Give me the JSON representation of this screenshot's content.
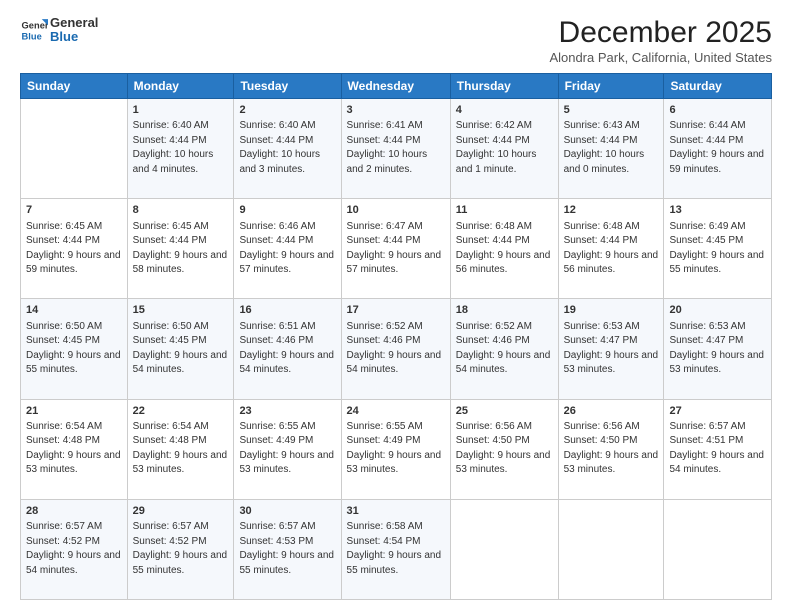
{
  "logo": {
    "line1": "General",
    "line2": "Blue"
  },
  "title": "December 2025",
  "location": "Alondra Park, California, United States",
  "days_header": [
    "Sunday",
    "Monday",
    "Tuesday",
    "Wednesday",
    "Thursday",
    "Friday",
    "Saturday"
  ],
  "weeks": [
    [
      {
        "day": "",
        "sunrise": "",
        "sunset": "",
        "daylight": ""
      },
      {
        "day": "1",
        "sunrise": "Sunrise: 6:40 AM",
        "sunset": "Sunset: 4:44 PM",
        "daylight": "Daylight: 10 hours and 4 minutes."
      },
      {
        "day": "2",
        "sunrise": "Sunrise: 6:40 AM",
        "sunset": "Sunset: 4:44 PM",
        "daylight": "Daylight: 10 hours and 3 minutes."
      },
      {
        "day": "3",
        "sunrise": "Sunrise: 6:41 AM",
        "sunset": "Sunset: 4:44 PM",
        "daylight": "Daylight: 10 hours and 2 minutes."
      },
      {
        "day": "4",
        "sunrise": "Sunrise: 6:42 AM",
        "sunset": "Sunset: 4:44 PM",
        "daylight": "Daylight: 10 hours and 1 minute."
      },
      {
        "day": "5",
        "sunrise": "Sunrise: 6:43 AM",
        "sunset": "Sunset: 4:44 PM",
        "daylight": "Daylight: 10 hours and 0 minutes."
      },
      {
        "day": "6",
        "sunrise": "Sunrise: 6:44 AM",
        "sunset": "Sunset: 4:44 PM",
        "daylight": "Daylight: 9 hours and 59 minutes."
      }
    ],
    [
      {
        "day": "7",
        "sunrise": "Sunrise: 6:45 AM",
        "sunset": "Sunset: 4:44 PM",
        "daylight": "Daylight: 9 hours and 59 minutes."
      },
      {
        "day": "8",
        "sunrise": "Sunrise: 6:45 AM",
        "sunset": "Sunset: 4:44 PM",
        "daylight": "Daylight: 9 hours and 58 minutes."
      },
      {
        "day": "9",
        "sunrise": "Sunrise: 6:46 AM",
        "sunset": "Sunset: 4:44 PM",
        "daylight": "Daylight: 9 hours and 57 minutes."
      },
      {
        "day": "10",
        "sunrise": "Sunrise: 6:47 AM",
        "sunset": "Sunset: 4:44 PM",
        "daylight": "Daylight: 9 hours and 57 minutes."
      },
      {
        "day": "11",
        "sunrise": "Sunrise: 6:48 AM",
        "sunset": "Sunset: 4:44 PM",
        "daylight": "Daylight: 9 hours and 56 minutes."
      },
      {
        "day": "12",
        "sunrise": "Sunrise: 6:48 AM",
        "sunset": "Sunset: 4:44 PM",
        "daylight": "Daylight: 9 hours and 56 minutes."
      },
      {
        "day": "13",
        "sunrise": "Sunrise: 6:49 AM",
        "sunset": "Sunset: 4:45 PM",
        "daylight": "Daylight: 9 hours and 55 minutes."
      }
    ],
    [
      {
        "day": "14",
        "sunrise": "Sunrise: 6:50 AM",
        "sunset": "Sunset: 4:45 PM",
        "daylight": "Daylight: 9 hours and 55 minutes."
      },
      {
        "day": "15",
        "sunrise": "Sunrise: 6:50 AM",
        "sunset": "Sunset: 4:45 PM",
        "daylight": "Daylight: 9 hours and 54 minutes."
      },
      {
        "day": "16",
        "sunrise": "Sunrise: 6:51 AM",
        "sunset": "Sunset: 4:46 PM",
        "daylight": "Daylight: 9 hours and 54 minutes."
      },
      {
        "day": "17",
        "sunrise": "Sunrise: 6:52 AM",
        "sunset": "Sunset: 4:46 PM",
        "daylight": "Daylight: 9 hours and 54 minutes."
      },
      {
        "day": "18",
        "sunrise": "Sunrise: 6:52 AM",
        "sunset": "Sunset: 4:46 PM",
        "daylight": "Daylight: 9 hours and 54 minutes."
      },
      {
        "day": "19",
        "sunrise": "Sunrise: 6:53 AM",
        "sunset": "Sunset: 4:47 PM",
        "daylight": "Daylight: 9 hours and 53 minutes."
      },
      {
        "day": "20",
        "sunrise": "Sunrise: 6:53 AM",
        "sunset": "Sunset: 4:47 PM",
        "daylight": "Daylight: 9 hours and 53 minutes."
      }
    ],
    [
      {
        "day": "21",
        "sunrise": "Sunrise: 6:54 AM",
        "sunset": "Sunset: 4:48 PM",
        "daylight": "Daylight: 9 hours and 53 minutes."
      },
      {
        "day": "22",
        "sunrise": "Sunrise: 6:54 AM",
        "sunset": "Sunset: 4:48 PM",
        "daylight": "Daylight: 9 hours and 53 minutes."
      },
      {
        "day": "23",
        "sunrise": "Sunrise: 6:55 AM",
        "sunset": "Sunset: 4:49 PM",
        "daylight": "Daylight: 9 hours and 53 minutes."
      },
      {
        "day": "24",
        "sunrise": "Sunrise: 6:55 AM",
        "sunset": "Sunset: 4:49 PM",
        "daylight": "Daylight: 9 hours and 53 minutes."
      },
      {
        "day": "25",
        "sunrise": "Sunrise: 6:56 AM",
        "sunset": "Sunset: 4:50 PM",
        "daylight": "Daylight: 9 hours and 53 minutes."
      },
      {
        "day": "26",
        "sunrise": "Sunrise: 6:56 AM",
        "sunset": "Sunset: 4:50 PM",
        "daylight": "Daylight: 9 hours and 53 minutes."
      },
      {
        "day": "27",
        "sunrise": "Sunrise: 6:57 AM",
        "sunset": "Sunset: 4:51 PM",
        "daylight": "Daylight: 9 hours and 54 minutes."
      }
    ],
    [
      {
        "day": "28",
        "sunrise": "Sunrise: 6:57 AM",
        "sunset": "Sunset: 4:52 PM",
        "daylight": "Daylight: 9 hours and 54 minutes."
      },
      {
        "day": "29",
        "sunrise": "Sunrise: 6:57 AM",
        "sunset": "Sunset: 4:52 PM",
        "daylight": "Daylight: 9 hours and 55 minutes."
      },
      {
        "day": "30",
        "sunrise": "Sunrise: 6:57 AM",
        "sunset": "Sunset: 4:53 PM",
        "daylight": "Daylight: 9 hours and 55 minutes."
      },
      {
        "day": "31",
        "sunrise": "Sunrise: 6:58 AM",
        "sunset": "Sunset: 4:54 PM",
        "daylight": "Daylight: 9 hours and 55 minutes."
      },
      {
        "day": "",
        "sunrise": "",
        "sunset": "",
        "daylight": ""
      },
      {
        "day": "",
        "sunrise": "",
        "sunset": "",
        "daylight": ""
      },
      {
        "day": "",
        "sunrise": "",
        "sunset": "",
        "daylight": ""
      }
    ]
  ]
}
